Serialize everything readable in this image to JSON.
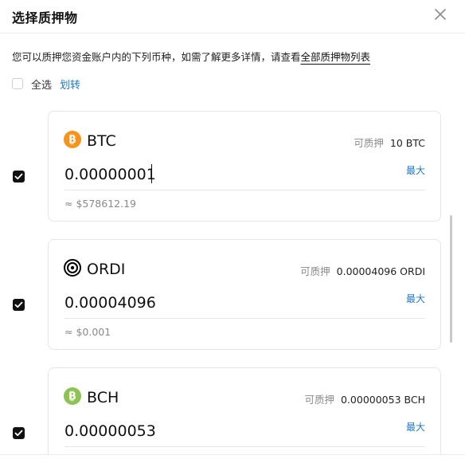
{
  "dialog": {
    "title": "选择质押物",
    "close_icon": "close-icon"
  },
  "description": {
    "text": "您可以质押您资金账户内的下列币种，如需了解更多详情，请查看",
    "link": "全部质押物列表"
  },
  "select_all": {
    "label": "全选",
    "transfer": "划转",
    "checked": false
  },
  "colors": {
    "accent_link": "#1f78c9",
    "btc": "#f7931a",
    "bch": "#8dc351",
    "ordi": "#000000"
  },
  "assets": [
    {
      "name": "BTC",
      "icon": "btc-coin-icon",
      "checked": true,
      "available_label": "可质押",
      "available_value": "10 BTC",
      "amount": "0.00000001",
      "max_label": "最大",
      "usd_value": "≈ $578612.19"
    },
    {
      "name": "ORDI",
      "icon": "ordi-coin-icon",
      "checked": true,
      "available_label": "可质押",
      "available_value": "0.00004096 ORDI",
      "amount": "0.00004096",
      "max_label": "最大",
      "usd_value": "≈ $0.001"
    },
    {
      "name": "BCH",
      "icon": "bch-coin-icon",
      "checked": true,
      "available_label": "可质押",
      "available_value": "0.00000053 BCH",
      "amount": "0.00000053",
      "max_label": "最大",
      "usd_value": ""
    }
  ]
}
